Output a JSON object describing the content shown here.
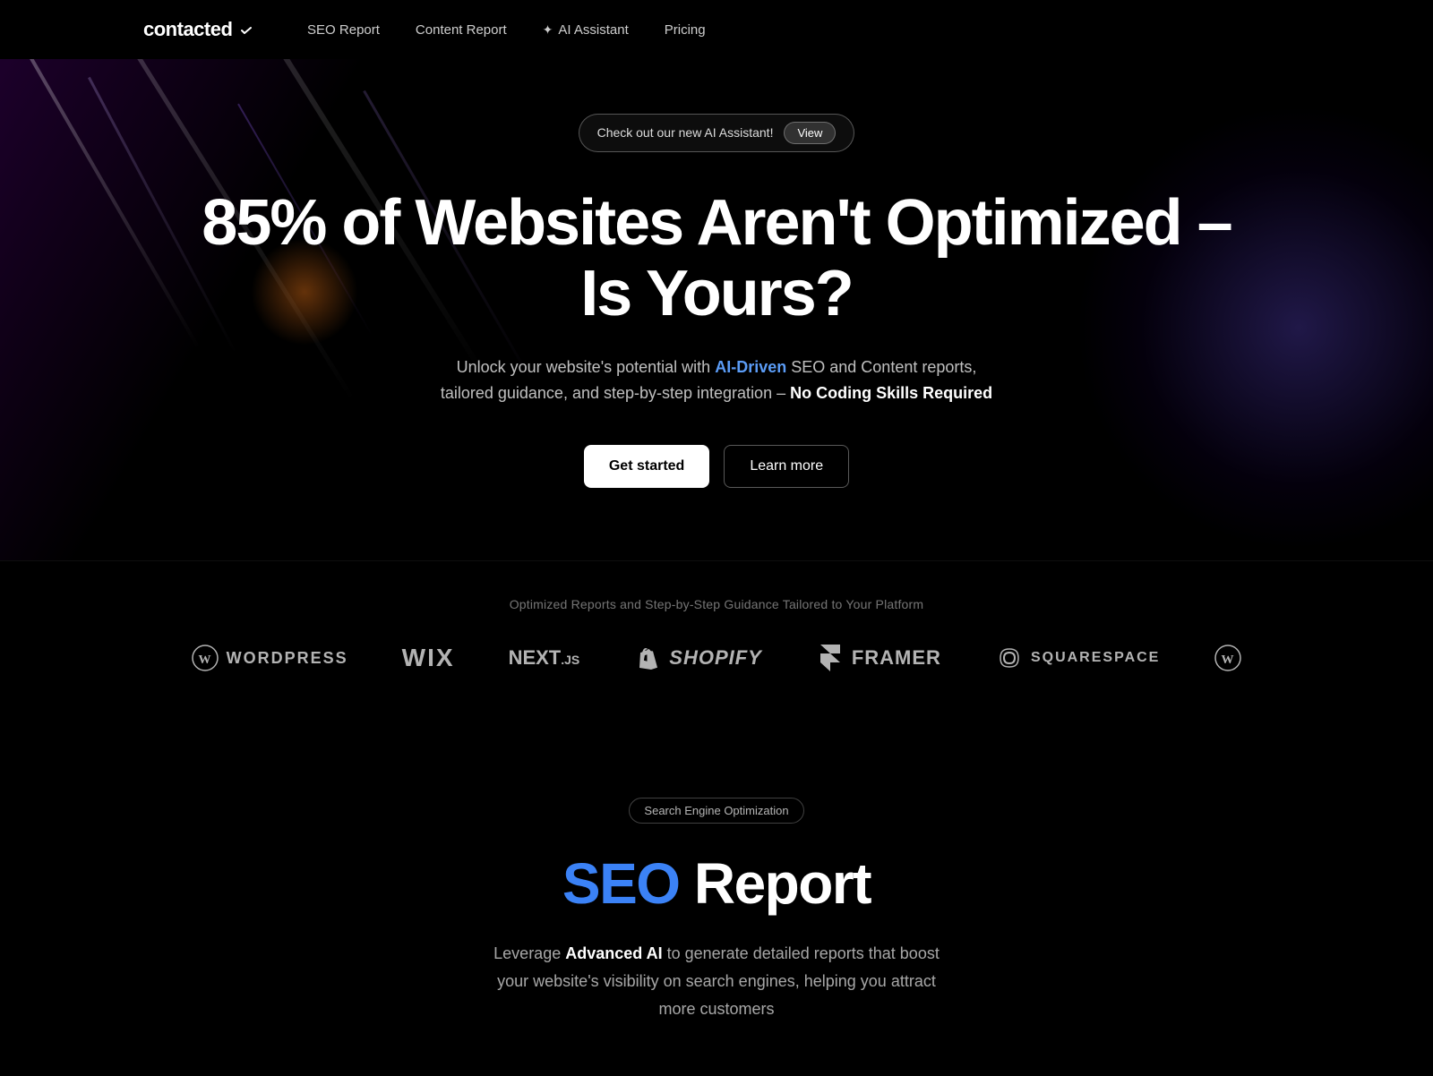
{
  "nav": {
    "logo": "contacted",
    "links": [
      {
        "label": "SEO Report",
        "href": "#"
      },
      {
        "label": "Content Report",
        "href": "#"
      },
      {
        "label": "AI Assistant",
        "href": "#",
        "hasIcon": true
      },
      {
        "label": "Pricing",
        "href": "#"
      }
    ]
  },
  "hero": {
    "banner_text": "Check out our new AI Assistant!",
    "banner_btn": "View",
    "title": "85% of Websites Aren't Optimized – Is Yours?",
    "subtitle_plain1": "Unlock your website's potential with",
    "subtitle_highlight1": "AI-Driven",
    "subtitle_plain2": "SEO and Content reports, tailored guidance, and step-by-step integration –",
    "subtitle_highlight2": "No Coding Skills Required",
    "btn_primary": "Get started",
    "btn_secondary": "Learn more"
  },
  "platforms": {
    "label": "Optimized Reports and Step-by-Step Guidance Tailored to Your Platform",
    "logos": [
      {
        "name": "WordPress",
        "type": "wordpress"
      },
      {
        "name": "Wix",
        "type": "wix"
      },
      {
        "name": "NEXT.js",
        "type": "nextjs"
      },
      {
        "name": "Shopify",
        "type": "shopify"
      },
      {
        "name": "Framer",
        "type": "framer"
      },
      {
        "name": "Squarespace",
        "type": "squarespace"
      },
      {
        "name": "WordPress",
        "type": "wordpress2"
      }
    ]
  },
  "seo_section": {
    "badge": "Search Engine Optimization",
    "title_blue": "SEO",
    "title_rest": " Report",
    "desc_plain1": "Leverage",
    "desc_highlight": "Advanced AI",
    "desc_plain2": "to generate detailed reports that boost your website's visibility on search engines, helping you attract more customers"
  }
}
